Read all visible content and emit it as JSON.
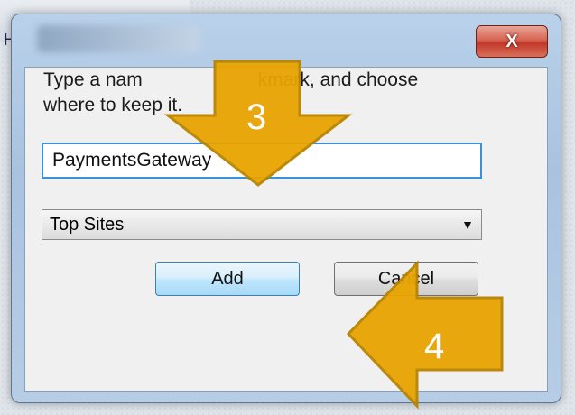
{
  "background": {
    "behind_label": "H"
  },
  "dialog": {
    "close_label": "X",
    "prompt": "Type a name for this bookmark, and choose where to keep it.",
    "prompt_visible_part1": "Type a nam",
    "prompt_visible_part2": "kmark, and choose",
    "prompt_visible_line2": "where to keep it.",
    "name_value": "PaymentsGateway",
    "folder_selected": "Top Sites",
    "add_label": "Add",
    "cancel_label": "Cancel"
  },
  "annotations": [
    {
      "label": "3",
      "color": "#e8a400"
    },
    {
      "label": "4",
      "color": "#e8a400"
    }
  ],
  "colors": {
    "arrow_fill": "#e8a400",
    "arrow_stroke": "#b88300",
    "input_focus_border": "#3e8fd8",
    "close_red": "#c2382a"
  }
}
